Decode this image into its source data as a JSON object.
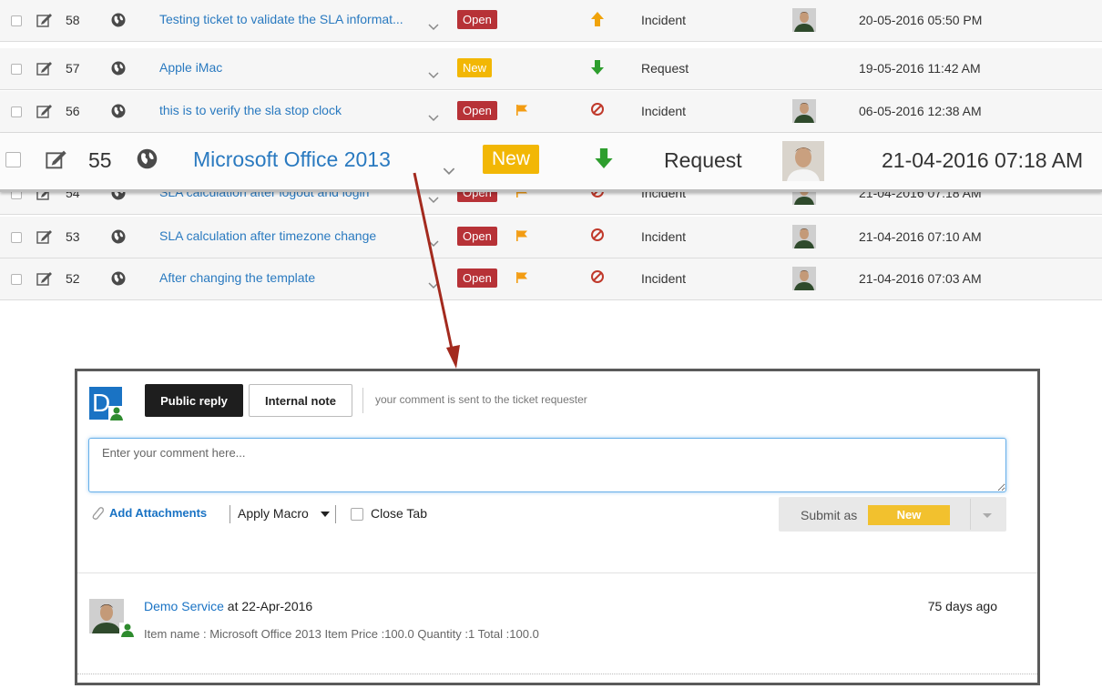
{
  "tickets": [
    {
      "id": "58",
      "subject": "Testing ticket to validate the SLA informat...",
      "status": "Open",
      "flag": false,
      "priority": "up",
      "type": "Incident",
      "avatar": true,
      "date": "20-05-2016 05:50 PM"
    },
    {
      "id": "57",
      "subject": "Apple iMac",
      "status": "New",
      "flag": false,
      "priority": "down",
      "type": "Request",
      "avatar": false,
      "date": "19-05-2016 11:42 AM"
    },
    {
      "id": "56",
      "subject": "this is to verify the sla stop clock",
      "status": "Open",
      "flag": true,
      "priority": "none",
      "type": "Incident",
      "avatar": true,
      "date": "06-05-2016 12:38 AM"
    },
    {
      "id": "54",
      "subject": "SLA calculation after logout and login",
      "status": "Open",
      "flag": true,
      "priority": "none",
      "type": "Incident",
      "avatar": true,
      "date": "21-04-2016 07:18 AM"
    },
    {
      "id": "53",
      "subject": "SLA calculation after timezone change",
      "status": "Open",
      "flag": true,
      "priority": "none",
      "type": "Incident",
      "avatar": true,
      "date": "21-04-2016 07:10 AM"
    },
    {
      "id": "52",
      "subject": "After changing the template",
      "status": "Open",
      "flag": true,
      "priority": "none",
      "type": "Incident",
      "avatar": true,
      "date": "21-04-2016 07:03 AM"
    }
  ],
  "highlighted": {
    "id": "55",
    "subject": "Microsoft Office 2013",
    "status": "New",
    "priority": "down",
    "type": "Request",
    "date": "21-04-2016 07:18 AM"
  },
  "colors": {
    "link": "#2a7ac0",
    "open": "#b73237",
    "new": "#f2b705",
    "priority_up": "#f0a30a",
    "priority_down": "#2e9e2e",
    "priority_none": "#c0392b",
    "flag": "#f39c12",
    "arrow": "#a32a1e",
    "user_tile": "#1a73c4"
  },
  "comment": {
    "user_initial": "D",
    "public_reply": "Public reply",
    "internal_note": "Internal note",
    "hint": "your comment is sent to the ticket requester",
    "placeholder": "Enter your comment here...",
    "add_attachments": "Add Attachments",
    "apply_macro": "Apply Macro",
    "close_tab": "Close Tab",
    "submit_as": "Submit as",
    "submit_status": "New"
  },
  "thread": {
    "author": "Demo Service",
    "at": " at 22-Apr-2016",
    "ago": "75 days ago",
    "body": "Item name : Microsoft Office 2013 Item Price :100.0 Quantity :1 Total :100.0"
  }
}
